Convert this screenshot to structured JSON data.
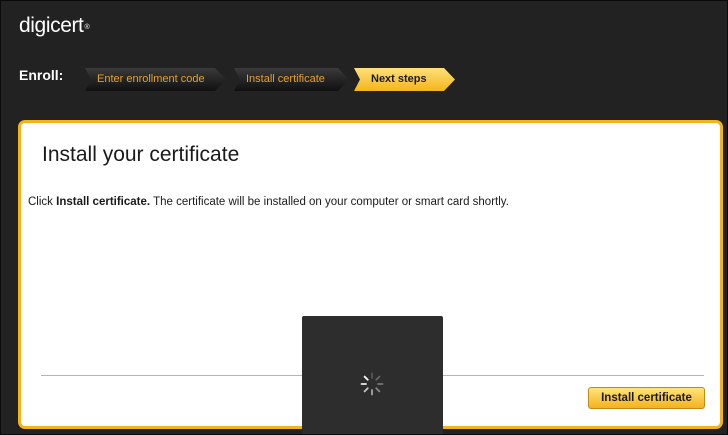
{
  "brand": {
    "logo_text": "digicert",
    "logo_mark": "®"
  },
  "nav": {
    "label": "Enroll:",
    "steps": [
      {
        "label": "Enter enrollment code",
        "state": "complete"
      },
      {
        "label": "Install certificate",
        "state": "complete"
      },
      {
        "label": "Next steps",
        "state": "current"
      }
    ]
  },
  "panel": {
    "title": "Install your certificate",
    "instruction_prefix": "Click ",
    "instruction_bold": "Install certificate.",
    "instruction_suffix": " The certificate will be installed on your computer or smart card shortly.",
    "install_button": "Install certificate"
  },
  "loading": {
    "icon": "spinner-icon"
  },
  "colors": {
    "accent": "#f2b31c",
    "background": "#222222",
    "step_text": "#e7a12a"
  }
}
